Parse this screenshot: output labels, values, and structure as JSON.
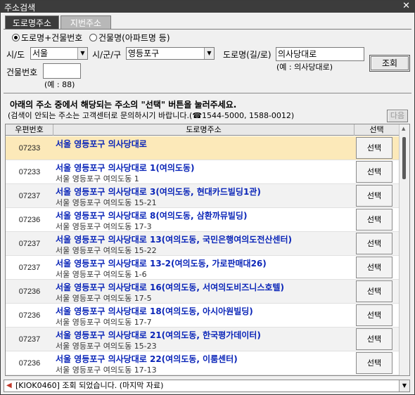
{
  "window": {
    "title": "주소검색",
    "close": "✕"
  },
  "tabs": [
    {
      "label": "도로명주소",
      "active": true
    },
    {
      "label": "지번주소",
      "active": false
    }
  ],
  "search_type": {
    "options": [
      {
        "label": "도로명+건물번호",
        "selected": true
      },
      {
        "label": "건물명(아파트명 등)",
        "selected": false
      }
    ]
  },
  "form": {
    "sido_label": "시/도",
    "sido_value": "서울",
    "sigungu_label": "시/군/구",
    "sigungu_value": "영등포구",
    "road_label": "도로명(길/로)",
    "road_value": "의사당대로",
    "road_example": "(예 : 의사당대로)",
    "building_label": "건물번호",
    "building_value": "",
    "building_example": "(예 : 88)",
    "search_button": "조회"
  },
  "guide": {
    "line1": "아래의 주소 중에서 해당되는 주소의 \"선택\" 버튼을 눌러주세요.",
    "line2": "(검색이 안되는 주소는 고객센터로 문의하시기 바랍니다.(☎1544-5000, 1588-0012)",
    "next_button": "다음"
  },
  "grid": {
    "columns": [
      "우편번호",
      "도로명주소",
      "선택"
    ],
    "select_label": "선택",
    "rows": [
      {
        "zip": "07233",
        "road": "서울 영등포구 의사당대로",
        "lot": ""
      },
      {
        "zip": "07233",
        "road": "서울 영등포구 의사당대로 1(여의도동)",
        "lot": "서울 영등포구 여의도동  1"
      },
      {
        "zip": "07237",
        "road": "서울 영등포구 의사당대로 3(여의도동, 현대카드빌딩1관)",
        "lot": "서울 영등포구 여의도동  15-21"
      },
      {
        "zip": "07236",
        "road": "서울 영등포구 의사당대로 8(여의도동, 삼환까뮤빌딩)",
        "lot": "서울 영등포구 여의도동  17-3"
      },
      {
        "zip": "07237",
        "road": "서울 영등포구 의사당대로 13(여의도동, 국민은행여의도전산센터)",
        "lot": "서울 영등포구 여의도동  15-22"
      },
      {
        "zip": "07237",
        "road": "서울 영등포구 의사당대로 13-2(여의도동, 가로판매대26)",
        "lot": "서울 영등포구 여의도동  1-6"
      },
      {
        "zip": "07236",
        "road": "서울 영등포구 의사당대로 16(여의도동, 서여의도비즈니스호텔)",
        "lot": "서울 영등포구 여의도동  17-5"
      },
      {
        "zip": "07236",
        "road": "서울 영등포구 의사당대로 18(여의도동, 아시아원빌딩)",
        "lot": "서울 영등포구 여의도동  17-7"
      },
      {
        "zip": "07237",
        "road": "서울 영등포구 의사당대로 21(여의도동, 한국평가데이터)",
        "lot": "서울 영등포구 여의도동  15-23"
      },
      {
        "zip": "07236",
        "road": "서울 영등포구 의사당대로 22(여의도동, 이룸센터)",
        "lot": "서울 영등포구 여의도동  17-13"
      }
    ]
  },
  "status": {
    "message": "[KIOK0460] 조회 되었습니다. (마지막 자료)"
  }
}
